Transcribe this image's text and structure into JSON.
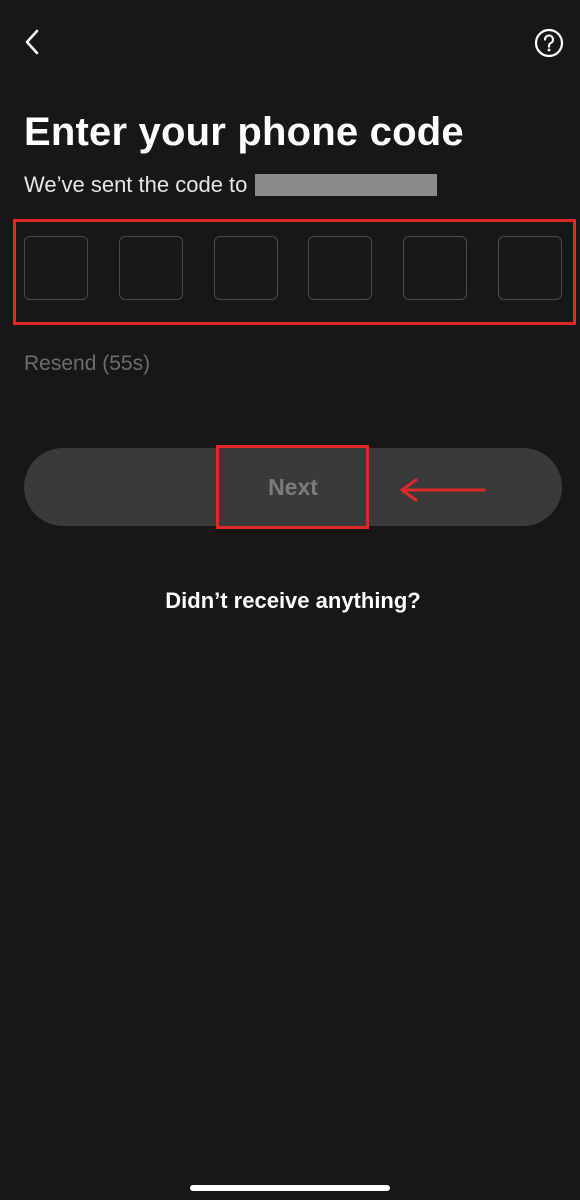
{
  "header": {
    "back_icon": "chevron-left-icon",
    "help_icon": "question-circle-icon"
  },
  "page": {
    "title": "Enter your phone code",
    "subtitle": "We’ve sent the code to",
    "phone_number_masked": true
  },
  "code_input": {
    "length": 6,
    "digits": [
      "",
      "",
      "",
      "",
      "",
      ""
    ]
  },
  "resend_label": "Resend (55s)",
  "next_button": {
    "label": "Next",
    "enabled": false
  },
  "help_link": "Didn’t receive anything?",
  "annotations": {
    "highlight_color": "#e02828",
    "arrow_icon": "arrow-left-icon"
  },
  "colors": {
    "background": "#171717",
    "button_disabled_bg": "#3a3a3a",
    "button_disabled_text": "#7c7c7c",
    "muted_text": "#6d6d6d"
  }
}
